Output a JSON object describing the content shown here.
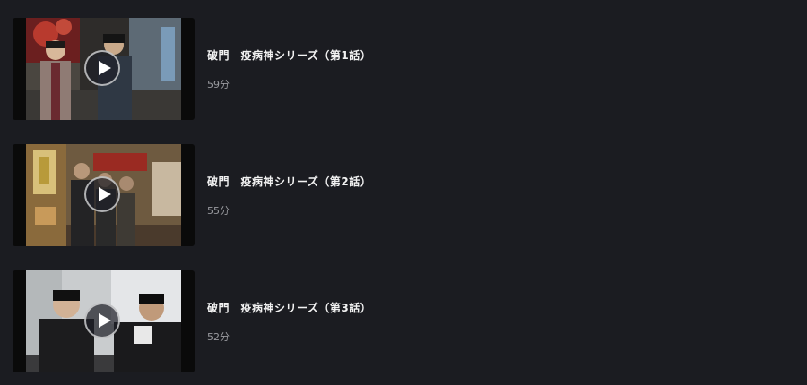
{
  "episodes": [
    {
      "title": "破門　疫病神シリーズ（第1話）",
      "duration": "59分"
    },
    {
      "title": "破門　疫病神シリーズ（第2話）",
      "duration": "55分"
    },
    {
      "title": "破門　疫病神シリーズ（第3話）",
      "duration": "52分"
    }
  ],
  "icons": {
    "play": "play-icon"
  },
  "colors": {
    "background": "#1b1c21",
    "title_text": "#f2f2f2",
    "duration_text": "#9a9ba0"
  }
}
